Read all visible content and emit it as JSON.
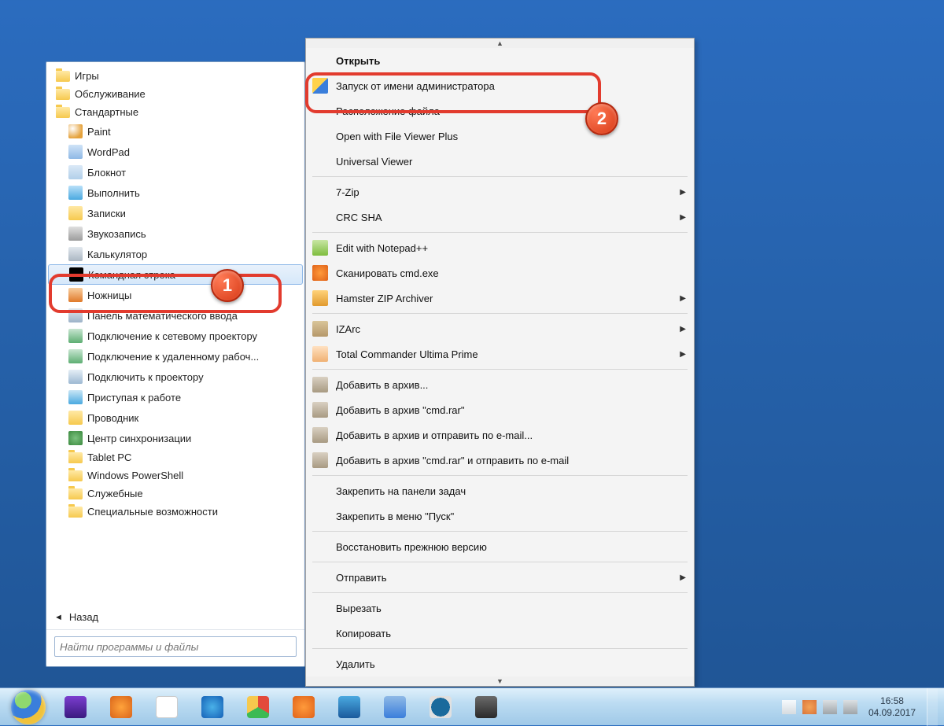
{
  "start": {
    "folders": [
      "Игры",
      "Обслуживание",
      "Стандартные"
    ],
    "items": [
      {
        "label": "Paint"
      },
      {
        "label": "WordPad"
      },
      {
        "label": "Блокнот"
      },
      {
        "label": "Выполнить"
      },
      {
        "label": "Записки"
      },
      {
        "label": "Звукозапись"
      },
      {
        "label": "Калькулятор"
      },
      {
        "label": "Командная строка"
      },
      {
        "label": "Ножницы"
      },
      {
        "label": "Панель математического ввода"
      },
      {
        "label": "Подключение к сетевому проектору"
      },
      {
        "label": "Подключение к удаленному рабоч..."
      },
      {
        "label": "Подключить к проектору"
      },
      {
        "label": "Приступая к работе"
      },
      {
        "label": "Проводник"
      },
      {
        "label": "Центр синхронизации"
      }
    ],
    "subfolders": [
      "Tablet PC",
      "Windows PowerShell",
      "Служебные",
      "Специальные возможности"
    ],
    "back": "Назад",
    "search_placeholder": "Найти программы и файлы"
  },
  "ctx": {
    "items": [
      {
        "label": "Открыть",
        "bold": true
      },
      {
        "label": "Запуск от имени администратора",
        "icon": "shield"
      },
      {
        "label": "Расположение файла"
      },
      {
        "label": "Open with File Viewer Plus"
      },
      {
        "label": "Universal Viewer"
      },
      {
        "sep": true
      },
      {
        "label": "7-Zip",
        "sub": true
      },
      {
        "label": "CRC SHA",
        "sub": true
      },
      {
        "sep": true
      },
      {
        "label": "Edit with Notepad++",
        "icon": "np"
      },
      {
        "label": "Сканировать cmd.exe",
        "icon": "avast"
      },
      {
        "label": "Hamster ZIP Archiver",
        "icon": "hamster",
        "sub": true
      },
      {
        "sep": true
      },
      {
        "label": "IZArc",
        "icon": "izarc",
        "sub": true
      },
      {
        "label": "Total Commander Ultima Prime",
        "icon": "tc",
        "sub": true
      },
      {
        "sep": true
      },
      {
        "label": "Добавить в архив...",
        "icon": "rar"
      },
      {
        "label": "Добавить в архив \"cmd.rar\"",
        "icon": "rar"
      },
      {
        "label": "Добавить в архив и отправить по e-mail...",
        "icon": "rar"
      },
      {
        "label": "Добавить в архив \"cmd.rar\" и отправить по e-mail",
        "icon": "rar"
      },
      {
        "sep": true
      },
      {
        "label": "Закрепить на панели задач"
      },
      {
        "label": "Закрепить в меню \"Пуск\""
      },
      {
        "sep": true
      },
      {
        "label": "Восстановить прежнюю версию"
      },
      {
        "sep": true
      },
      {
        "label": "Отправить",
        "sub": true
      },
      {
        "sep": true
      },
      {
        "label": "Вырезать"
      },
      {
        "label": "Копировать"
      },
      {
        "sep": true
      },
      {
        "label": "Удалить"
      }
    ]
  },
  "badges": {
    "one": "1",
    "two": "2"
  },
  "clock": {
    "time": "16:58",
    "date": "04.09.2017"
  }
}
